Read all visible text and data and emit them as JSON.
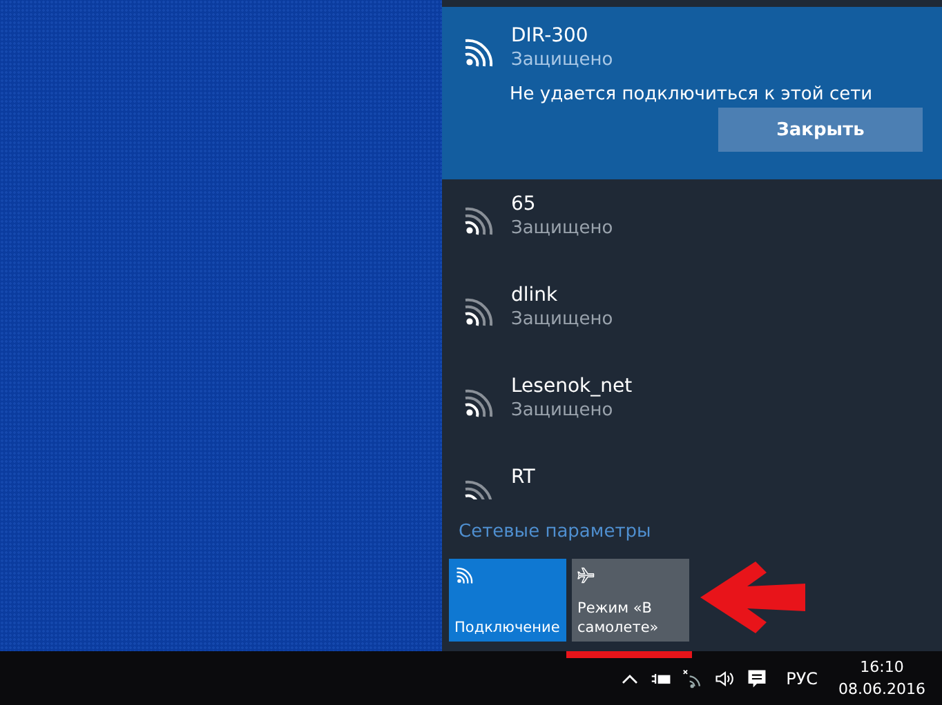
{
  "networks": [
    {
      "name": "DIR-300",
      "status": "Защищено",
      "expanded": true,
      "message": "Не удается подключиться к этой сети",
      "button": "Закрыть"
    },
    {
      "name": "65",
      "status": "Защищено",
      "expanded": false
    },
    {
      "name": "dlink",
      "status": "Защищено",
      "expanded": false
    },
    {
      "name": "Lesenok_net",
      "status": "Защищено",
      "expanded": false
    },
    {
      "name": "RT",
      "expanded": false
    }
  ],
  "settings_link": "Сетевые параметры",
  "quick_actions": [
    {
      "kind": "wifi",
      "label": "Подключение",
      "on": true
    },
    {
      "kind": "airplane",
      "label": "Режим «В самолете»",
      "on": false
    }
  ],
  "taskbar": {
    "language": "РУС",
    "time": "16:10",
    "date": "08.06.2016"
  }
}
